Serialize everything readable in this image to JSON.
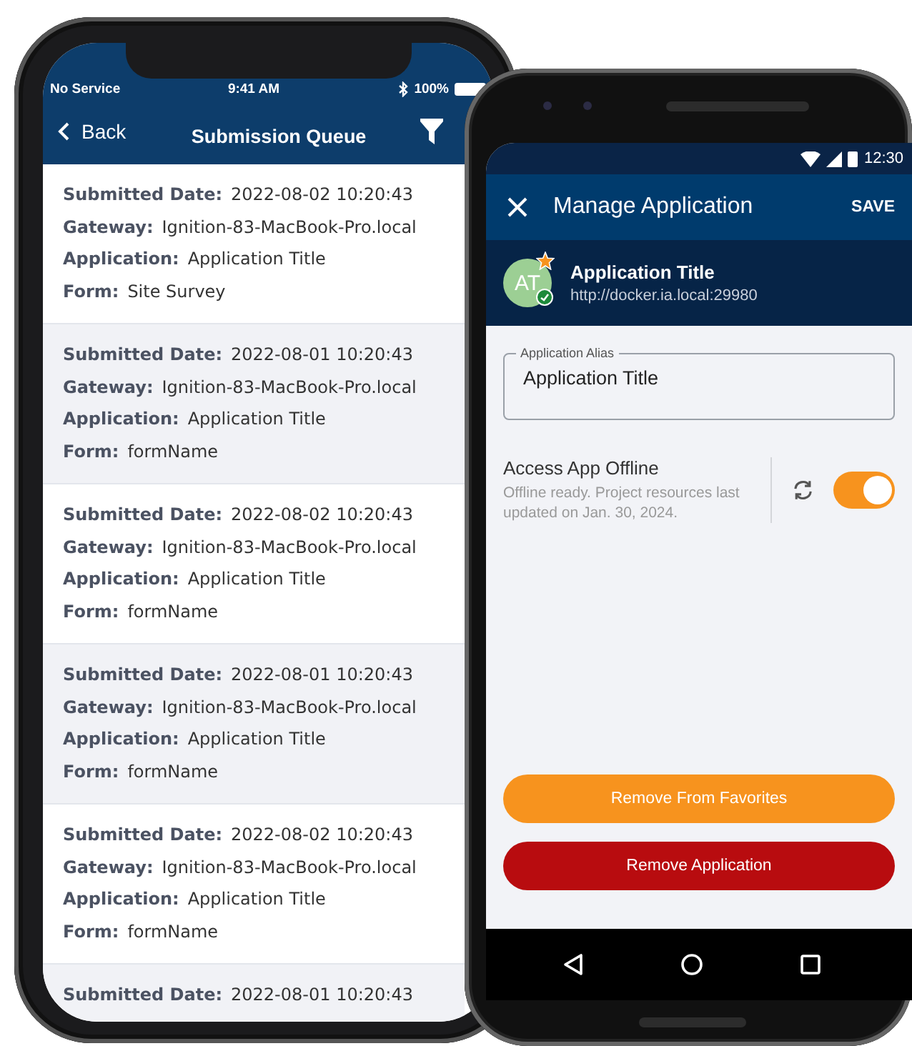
{
  "queue_phone": {
    "status_bar": {
      "carrier": "No Service",
      "time": "9:41 AM",
      "battery": "100%"
    },
    "nav": {
      "back": "Back",
      "title": "Submission Queue"
    },
    "submissions": [
      {
        "fields": [
          {
            "label": "Submitted Date:",
            "value": "2022-08-02 10:20:43"
          },
          {
            "label": "Gateway:",
            "value": "Ignition-83-MacBook-Pro.local"
          },
          {
            "label": "Application:",
            "value": "Application Title"
          },
          {
            "label": "Form:",
            "value": "Site Survey"
          }
        ]
      },
      {
        "fields": [
          {
            "label": "Submitted Date:",
            "value": "2022-08-01 10:20:43"
          },
          {
            "label": "Gateway:",
            "value": "Ignition-83-MacBook-Pro.local"
          },
          {
            "label": "Application:",
            "value": "Application Title"
          },
          {
            "label": "Form:",
            "value": "formName"
          }
        ]
      },
      {
        "fields": [
          {
            "label": "Submitted Date:",
            "value": "2022-08-02 10:20:43"
          },
          {
            "label": "Gateway:",
            "value": "Ignition-83-MacBook-Pro.local"
          },
          {
            "label": "Application:",
            "value": "Application Title"
          },
          {
            "label": "Form:",
            "value": "formName"
          }
        ]
      },
      {
        "fields": [
          {
            "label": "Submitted Date:",
            "value": "2022-08-01 10:20:43"
          },
          {
            "label": "Gateway:",
            "value": "Ignition-83-MacBook-Pro.local"
          },
          {
            "label": "Application:",
            "value": "Application Title"
          },
          {
            "label": "Form:",
            "value": "formName"
          }
        ]
      },
      {
        "fields": [
          {
            "label": "Submitted Date:",
            "value": "2022-08-02 10:20:43"
          },
          {
            "label": "Gateway:",
            "value": "Ignition-83-MacBook-Pro.local"
          },
          {
            "label": "Application:",
            "value": "Application Title"
          },
          {
            "label": "Form:",
            "value": "formName"
          }
        ]
      },
      {
        "fields": [
          {
            "label": "Submitted Date:",
            "value": "2022-08-01 10:20:43"
          }
        ]
      }
    ]
  },
  "manage_phone": {
    "status_bar": {
      "time": "12:30"
    },
    "header": {
      "title": "Manage Application",
      "action": "SAVE"
    },
    "app": {
      "initials": "AT",
      "favorite": true,
      "title": "Application Title",
      "url": "http://docker.ia.local:29980"
    },
    "alias_field": {
      "label": "Application Alias",
      "value": "Application Title"
    },
    "offline": {
      "title": "Access App Offline",
      "description": "Offline ready. Project resources last updated on Jan. 30, 2024.",
      "on": true
    },
    "buttons": [
      {
        "label": "Remove From Favorites",
        "kind": "warning"
      },
      {
        "label": "Remove Application",
        "kind": "danger"
      }
    ]
  }
}
